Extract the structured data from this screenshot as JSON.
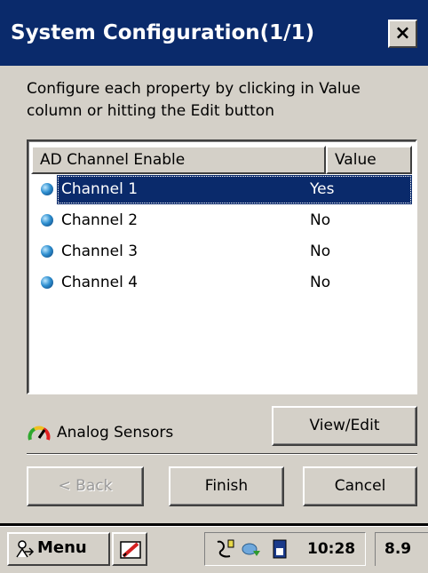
{
  "window": {
    "title": "System Configuration(1/1)",
    "close_label": "×"
  },
  "instructions": "Configure each property by clicking in Value column or hitting the Edit button",
  "list": {
    "columns": [
      "AD Channel Enable",
      "Value"
    ],
    "rows": [
      {
        "name": "Channel 1",
        "value": "Yes",
        "selected": true
      },
      {
        "name": "Channel 2",
        "value": "No",
        "selected": false
      },
      {
        "name": "Channel 3",
        "value": "No",
        "selected": false
      },
      {
        "name": "Channel 4",
        "value": "No",
        "selected": false
      }
    ]
  },
  "sensors": {
    "label": "Analog Sensors",
    "icon": "gauge-icon"
  },
  "buttons": {
    "view_edit": "View/Edit",
    "back": "< Back",
    "finish": "Finish",
    "cancel": "Cancel"
  },
  "taskbar": {
    "menu_label": "Menu",
    "clock": "10:28",
    "battery": "8.9",
    "icons": [
      "start-menu-icon",
      "pen-input-icon",
      "usb-connection-icon",
      "network-icon",
      "storage-card-icon"
    ]
  },
  "colors": {
    "titlebar": "#0a2a6b",
    "selection": "#0a2a6b",
    "face": "#d4d0c8"
  }
}
